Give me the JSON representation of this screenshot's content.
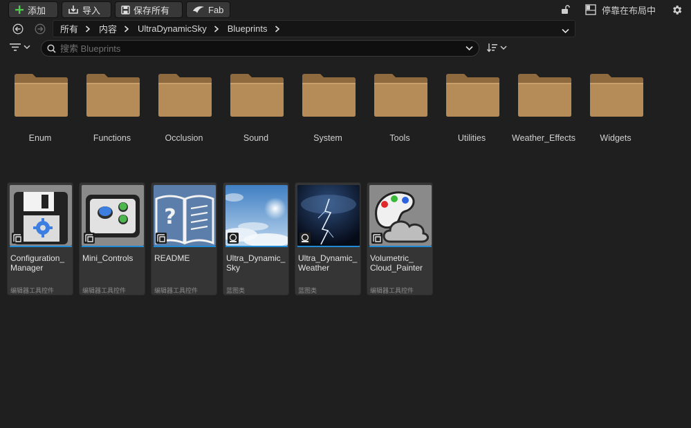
{
  "toolbar": {
    "add_label": "添加",
    "import_label": "导入",
    "save_all_label": "保存所有",
    "fab_label": "Fab",
    "dock_label": "停靠在布局中"
  },
  "breadcrumb": {
    "items": [
      "所有",
      "内容",
      "UltraDynamicSky",
      "Blueprints"
    ]
  },
  "search": {
    "placeholder": "搜索 Blueprints",
    "value": ""
  },
  "folders": [
    {
      "label": "Enum"
    },
    {
      "label": "Functions"
    },
    {
      "label": "Occlusion"
    },
    {
      "label": "Sound"
    },
    {
      "label": "System"
    },
    {
      "label": "Tools"
    },
    {
      "label": "Utilities"
    },
    {
      "label": "Weather_Effects"
    },
    {
      "label": "Widgets"
    }
  ],
  "assets": [
    {
      "name": "Configuration_\nManager",
      "kind": "编辑器工具控件",
      "icon": "floppy-gear-icon"
    },
    {
      "name": "Mini_Controls",
      "kind": "编辑器工具控件",
      "icon": "controls-icon"
    },
    {
      "name": "README",
      "kind": "编辑器工具控件",
      "icon": "book-question-icon"
    },
    {
      "name": "Ultra_Dynamic_\nSky",
      "kind": "蓝图类",
      "icon": "sky-icon"
    },
    {
      "name": "Ultra_Dynamic_\nWeather",
      "kind": "蓝图类",
      "icon": "lightning-icon"
    },
    {
      "name": "Volumetric_\nCloud_Painter",
      "kind": "编辑器工具控件",
      "icon": "palette-cloud-icon"
    }
  ],
  "colors": {
    "accent_bar": "#1f8ad6",
    "folder": "#b58c57",
    "add_green": "#4ec94e"
  }
}
